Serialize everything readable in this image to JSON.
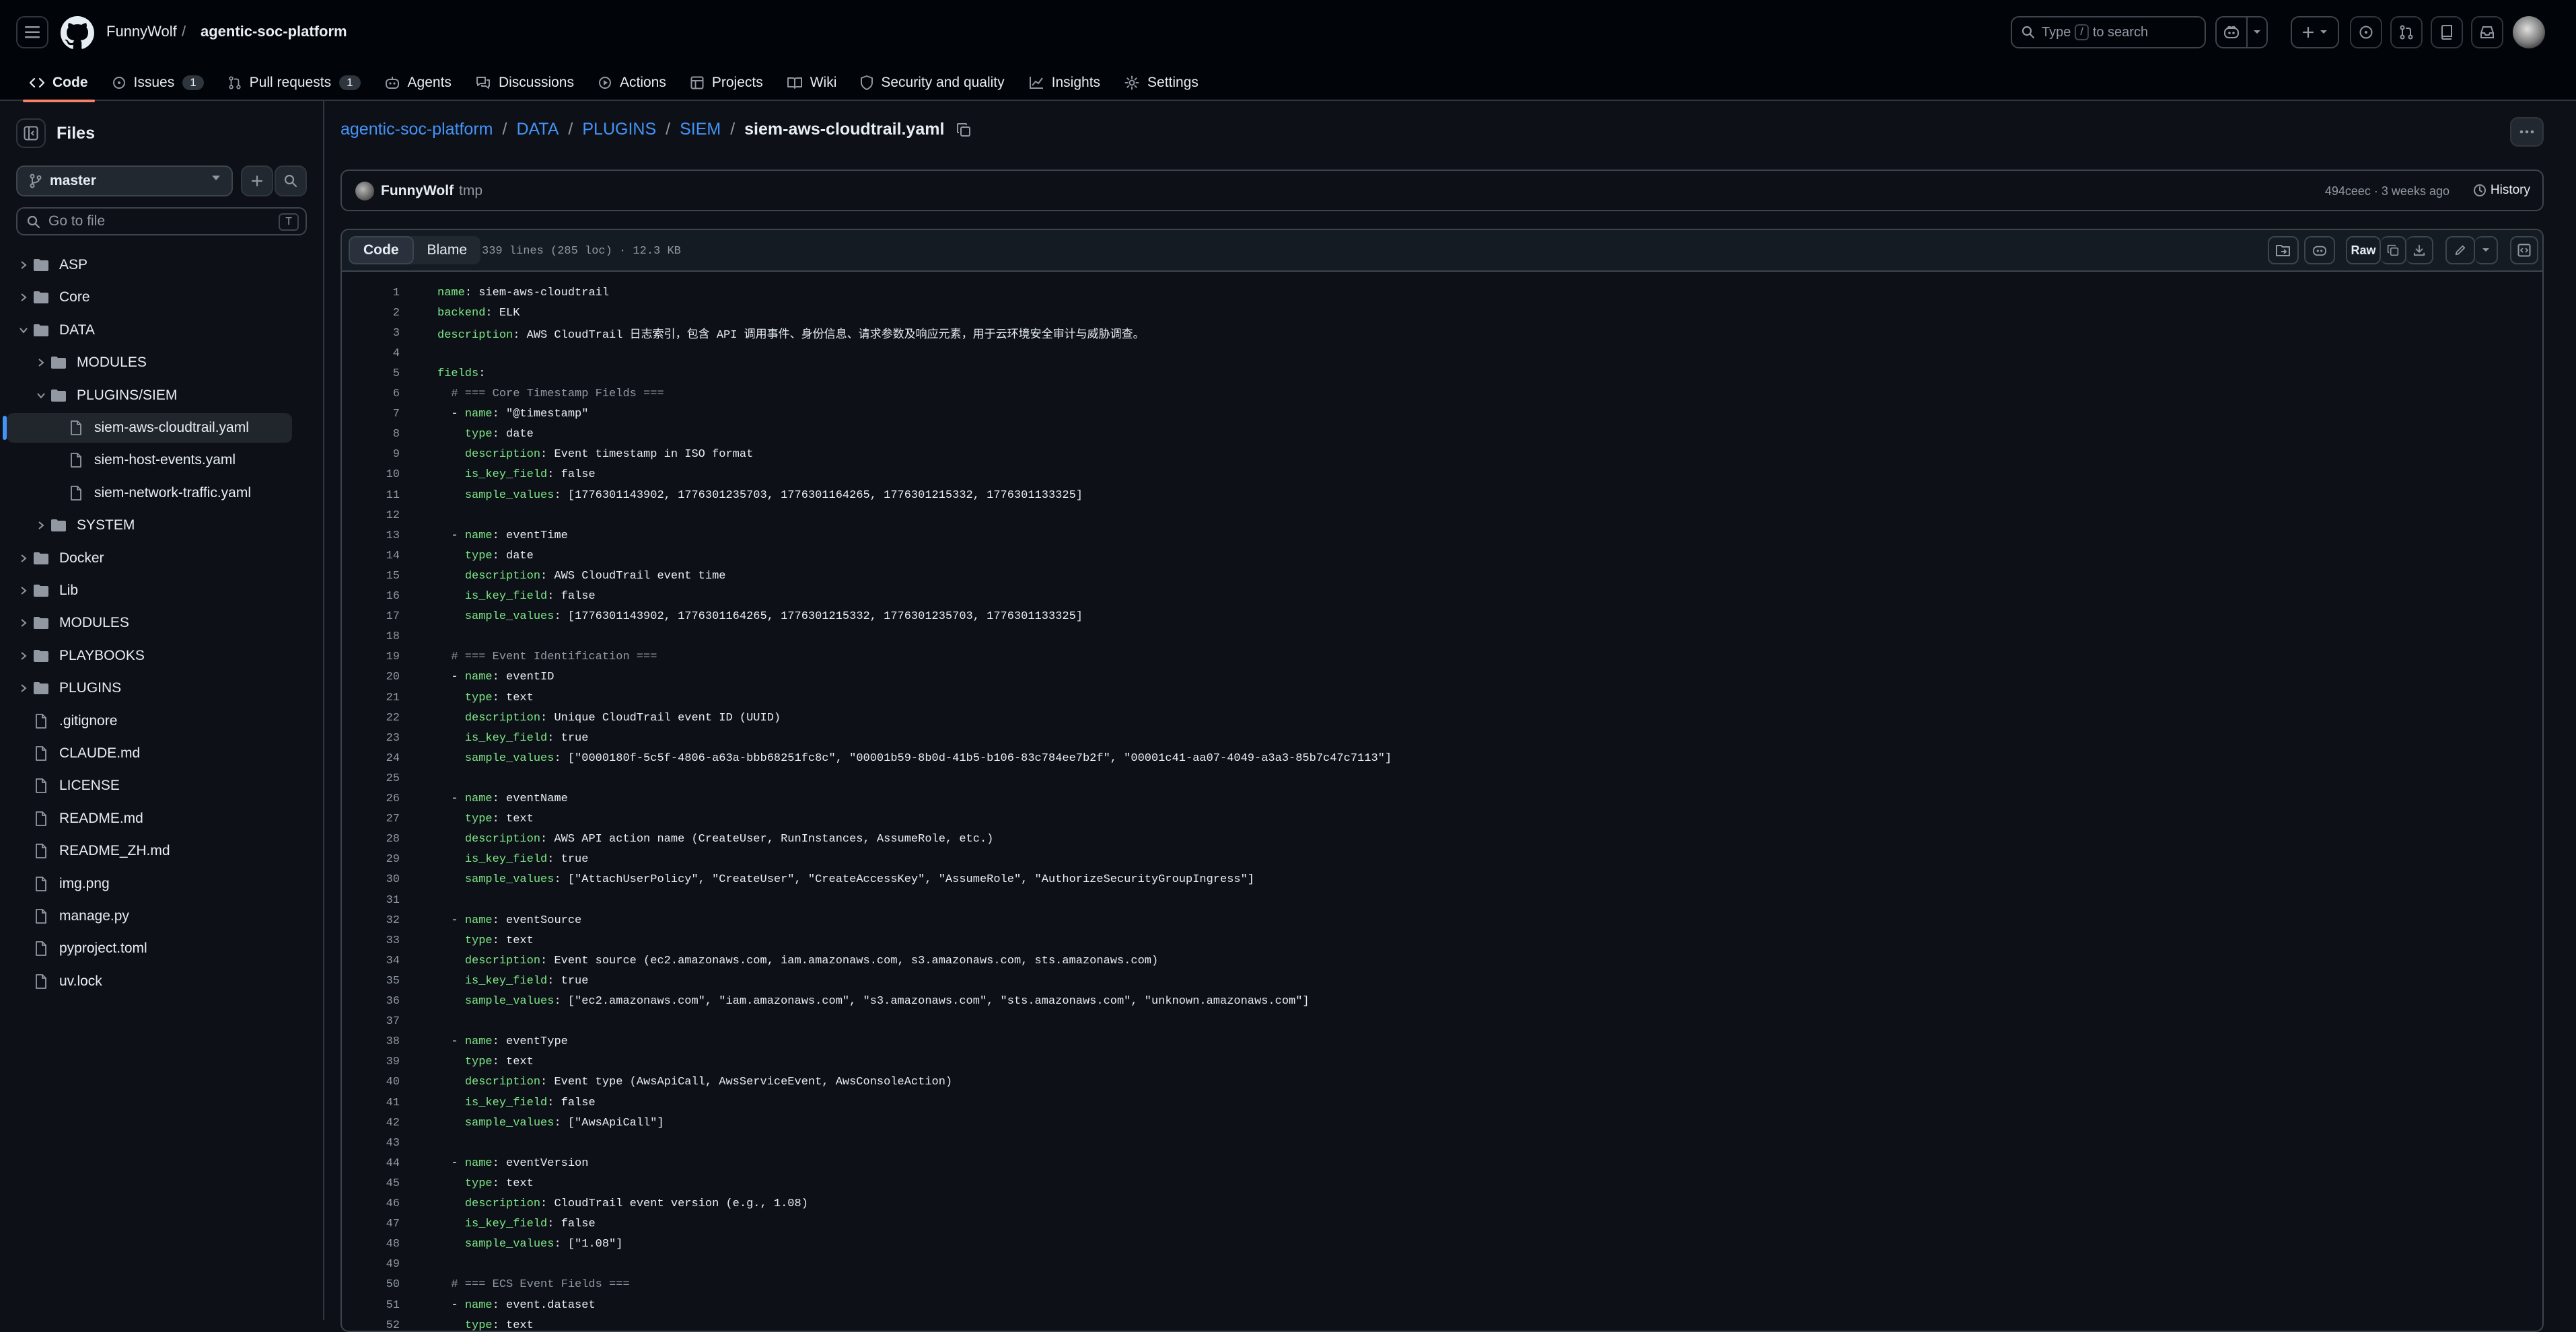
{
  "header": {
    "owner": "FunnyWolf",
    "separator": "/",
    "repo": "agentic-soc-platform",
    "search": {
      "prefix": "Type",
      "key": "/",
      "suffix": "to search"
    }
  },
  "nav": {
    "tabs": [
      {
        "label": "Code",
        "icon": "code-icon",
        "active": true
      },
      {
        "label": "Issues",
        "icon": "issue-icon",
        "count": "1"
      },
      {
        "label": "Pull requests",
        "icon": "pull-request-icon",
        "count": "1"
      },
      {
        "label": "Agents",
        "icon": "agent-icon"
      },
      {
        "label": "Discussions",
        "icon": "discussion-icon"
      },
      {
        "label": "Actions",
        "icon": "play-icon"
      },
      {
        "label": "Projects",
        "icon": "table-icon"
      },
      {
        "label": "Wiki",
        "icon": "book-icon"
      },
      {
        "label": "Security and quality",
        "icon": "shield-icon"
      },
      {
        "label": "Insights",
        "icon": "graph-icon"
      },
      {
        "label": "Settings",
        "icon": "gear-icon"
      }
    ]
  },
  "sidebar": {
    "title": "Files",
    "branch": "master",
    "goto_placeholder": "Go to file",
    "goto_key": "T",
    "tree": [
      {
        "label": "ASP",
        "type": "folder",
        "level": 0,
        "expanded": false
      },
      {
        "label": "Core",
        "type": "folder",
        "level": 0,
        "expanded": false
      },
      {
        "label": "DATA",
        "type": "folder",
        "level": 0,
        "expanded": true
      },
      {
        "label": "MODULES",
        "type": "folder",
        "level": 1,
        "expanded": false
      },
      {
        "label": "PLUGINS/SIEM",
        "type": "folder",
        "level": 1,
        "expanded": true
      },
      {
        "label": "siem-aws-cloudtrail.yaml",
        "type": "file",
        "level": 2,
        "selected": true
      },
      {
        "label": "siem-host-events.yaml",
        "type": "file",
        "level": 2
      },
      {
        "label": "siem-network-traffic.yaml",
        "type": "file",
        "level": 2
      },
      {
        "label": "SYSTEM",
        "type": "folder",
        "level": 1,
        "expanded": false
      },
      {
        "label": "Docker",
        "type": "folder",
        "level": 0,
        "expanded": false
      },
      {
        "label": "Lib",
        "type": "folder",
        "level": 0,
        "expanded": false
      },
      {
        "label": "MODULES",
        "type": "folder",
        "level": 0,
        "expanded": false
      },
      {
        "label": "PLAYBOOKS",
        "type": "folder",
        "level": 0,
        "expanded": false
      },
      {
        "label": "PLUGINS",
        "type": "folder",
        "level": 0,
        "expanded": false
      },
      {
        "label": ".gitignore",
        "type": "file",
        "level": 0
      },
      {
        "label": "CLAUDE.md",
        "type": "file",
        "level": 0
      },
      {
        "label": "LICENSE",
        "type": "file",
        "level": 0
      },
      {
        "label": "README.md",
        "type": "file",
        "level": 0
      },
      {
        "label": "README_ZH.md",
        "type": "file",
        "level": 0
      },
      {
        "label": "img.png",
        "type": "file",
        "level": 0
      },
      {
        "label": "manage.py",
        "type": "file",
        "level": 0
      },
      {
        "label": "pyproject.toml",
        "type": "file",
        "level": 0
      },
      {
        "label": "uv.lock",
        "type": "file",
        "level": 0
      }
    ]
  },
  "path": {
    "parts": [
      "agentic-soc-platform",
      "DATA",
      "PLUGINS",
      "SIEM"
    ],
    "separator": "/",
    "current": "siem-aws-cloudtrail.yaml"
  },
  "commit": {
    "author": "FunnyWolf",
    "message": "tmp",
    "meta": "494ceec · 3 weeks ago",
    "history_label": "History"
  },
  "file": {
    "tab_code": "Code",
    "tab_blame": "Blame",
    "info": "339 lines (285 loc) · 12.3 KB",
    "raw_label": "Raw",
    "lines": [
      [
        "1",
        [
          [
            "k",
            "name"
          ],
          [
            "p",
            ": "
          ],
          [
            "v",
            "siem-aws-cloudtrail"
          ]
        ]
      ],
      [
        "2",
        [
          [
            "k",
            "backend"
          ],
          [
            "p",
            ": "
          ],
          [
            "v",
            "ELK"
          ]
        ]
      ],
      [
        "3",
        [
          [
            "k",
            "description"
          ],
          [
            "p",
            ": "
          ],
          [
            "v",
            "AWS CloudTrail 日志索引，包含 API 调用事件、身份信息、请求参数及响应元素，用于云环境安全审计与威胁调查。"
          ]
        ]
      ],
      [
        "4",
        []
      ],
      [
        "5",
        [
          [
            "k",
            "fields"
          ],
          [
            "p",
            ":"
          ]
        ]
      ],
      [
        "6",
        [
          [
            "c",
            "  # === Core Timestamp Fields ==="
          ]
        ]
      ],
      [
        "7",
        [
          [
            "p",
            "  - "
          ],
          [
            "k",
            "name"
          ],
          [
            "p",
            ": "
          ],
          [
            "v",
            "\"@timestamp\""
          ]
        ]
      ],
      [
        "8",
        [
          [
            "p",
            "    "
          ],
          [
            "k",
            "type"
          ],
          [
            "p",
            ": "
          ],
          [
            "v",
            "date"
          ]
        ]
      ],
      [
        "9",
        [
          [
            "p",
            "    "
          ],
          [
            "k",
            "description"
          ],
          [
            "p",
            ": "
          ],
          [
            "v",
            "Event timestamp in ISO format"
          ]
        ]
      ],
      [
        "10",
        [
          [
            "p",
            "    "
          ],
          [
            "k",
            "is_key_field"
          ],
          [
            "p",
            ": "
          ],
          [
            "v",
            "false"
          ]
        ]
      ],
      [
        "11",
        [
          [
            "p",
            "    "
          ],
          [
            "k",
            "sample_values"
          ],
          [
            "p",
            ": "
          ],
          [
            "v",
            "[1776301143902, 1776301235703, 1776301164265, 1776301215332, 1776301133325]"
          ]
        ]
      ],
      [
        "12",
        []
      ],
      [
        "13",
        [
          [
            "p",
            "  - "
          ],
          [
            "k",
            "name"
          ],
          [
            "p",
            ": "
          ],
          [
            "v",
            "eventTime"
          ]
        ]
      ],
      [
        "14",
        [
          [
            "p",
            "    "
          ],
          [
            "k",
            "type"
          ],
          [
            "p",
            ": "
          ],
          [
            "v",
            "date"
          ]
        ]
      ],
      [
        "15",
        [
          [
            "p",
            "    "
          ],
          [
            "k",
            "description"
          ],
          [
            "p",
            ": "
          ],
          [
            "v",
            "AWS CloudTrail event time"
          ]
        ]
      ],
      [
        "16",
        [
          [
            "p",
            "    "
          ],
          [
            "k",
            "is_key_field"
          ],
          [
            "p",
            ": "
          ],
          [
            "v",
            "false"
          ]
        ]
      ],
      [
        "17",
        [
          [
            "p",
            "    "
          ],
          [
            "k",
            "sample_values"
          ],
          [
            "p",
            ": "
          ],
          [
            "v",
            "[1776301143902, 1776301164265, 1776301215332, 1776301235703, 1776301133325]"
          ]
        ]
      ],
      [
        "18",
        []
      ],
      [
        "19",
        [
          [
            "c",
            "  # === Event Identification ==="
          ]
        ]
      ],
      [
        "20",
        [
          [
            "p",
            "  - "
          ],
          [
            "k",
            "name"
          ],
          [
            "p",
            ": "
          ],
          [
            "v",
            "eventID"
          ]
        ]
      ],
      [
        "21",
        [
          [
            "p",
            "    "
          ],
          [
            "k",
            "type"
          ],
          [
            "p",
            ": "
          ],
          [
            "v",
            "text"
          ]
        ]
      ],
      [
        "22",
        [
          [
            "p",
            "    "
          ],
          [
            "k",
            "description"
          ],
          [
            "p",
            ": "
          ],
          [
            "v",
            "Unique CloudTrail event ID (UUID)"
          ]
        ]
      ],
      [
        "23",
        [
          [
            "p",
            "    "
          ],
          [
            "k",
            "is_key_field"
          ],
          [
            "p",
            ": "
          ],
          [
            "v",
            "true"
          ]
        ]
      ],
      [
        "24",
        [
          [
            "p",
            "    "
          ],
          [
            "k",
            "sample_values"
          ],
          [
            "p",
            ": "
          ],
          [
            "v",
            "[\"0000180f-5c5f-4806-a63a-bbb68251fc8c\", \"00001b59-8b0d-41b5-b106-83c784ee7b2f\", \"00001c41-aa07-4049-a3a3-85b7c47c7113\"]"
          ]
        ]
      ],
      [
        "25",
        []
      ],
      [
        "26",
        [
          [
            "p",
            "  - "
          ],
          [
            "k",
            "name"
          ],
          [
            "p",
            ": "
          ],
          [
            "v",
            "eventName"
          ]
        ]
      ],
      [
        "27",
        [
          [
            "p",
            "    "
          ],
          [
            "k",
            "type"
          ],
          [
            "p",
            ": "
          ],
          [
            "v",
            "text"
          ]
        ]
      ],
      [
        "28",
        [
          [
            "p",
            "    "
          ],
          [
            "k",
            "description"
          ],
          [
            "p",
            ": "
          ],
          [
            "v",
            "AWS API action name (CreateUser, RunInstances, AssumeRole, etc.)"
          ]
        ]
      ],
      [
        "29",
        [
          [
            "p",
            "    "
          ],
          [
            "k",
            "is_key_field"
          ],
          [
            "p",
            ": "
          ],
          [
            "v",
            "true"
          ]
        ]
      ],
      [
        "30",
        [
          [
            "p",
            "    "
          ],
          [
            "k",
            "sample_values"
          ],
          [
            "p",
            ": "
          ],
          [
            "v",
            "[\"AttachUserPolicy\", \"CreateUser\", \"CreateAccessKey\", \"AssumeRole\", \"AuthorizeSecurityGroupIngress\"]"
          ]
        ]
      ],
      [
        "31",
        []
      ],
      [
        "32",
        [
          [
            "p",
            "  - "
          ],
          [
            "k",
            "name"
          ],
          [
            "p",
            ": "
          ],
          [
            "v",
            "eventSource"
          ]
        ]
      ],
      [
        "33",
        [
          [
            "p",
            "    "
          ],
          [
            "k",
            "type"
          ],
          [
            "p",
            ": "
          ],
          [
            "v",
            "text"
          ]
        ]
      ],
      [
        "34",
        [
          [
            "p",
            "    "
          ],
          [
            "k",
            "description"
          ],
          [
            "p",
            ": "
          ],
          [
            "v",
            "Event source (ec2.amazonaws.com, iam.amazonaws.com, s3.amazonaws.com, sts.amazonaws.com)"
          ]
        ]
      ],
      [
        "35",
        [
          [
            "p",
            "    "
          ],
          [
            "k",
            "is_key_field"
          ],
          [
            "p",
            ": "
          ],
          [
            "v",
            "true"
          ]
        ]
      ],
      [
        "36",
        [
          [
            "p",
            "    "
          ],
          [
            "k",
            "sample_values"
          ],
          [
            "p",
            ": "
          ],
          [
            "v",
            "[\"ec2.amazonaws.com\", \"iam.amazonaws.com\", \"s3.amazonaws.com\", \"sts.amazonaws.com\", \"unknown.amazonaws.com\"]"
          ]
        ]
      ],
      [
        "37",
        []
      ],
      [
        "38",
        [
          [
            "p",
            "  - "
          ],
          [
            "k",
            "name"
          ],
          [
            "p",
            ": "
          ],
          [
            "v",
            "eventType"
          ]
        ]
      ],
      [
        "39",
        [
          [
            "p",
            "    "
          ],
          [
            "k",
            "type"
          ],
          [
            "p",
            ": "
          ],
          [
            "v",
            "text"
          ]
        ]
      ],
      [
        "40",
        [
          [
            "p",
            "    "
          ],
          [
            "k",
            "description"
          ],
          [
            "p",
            ": "
          ],
          [
            "v",
            "Event type (AwsApiCall, AwsServiceEvent, AwsConsoleAction)"
          ]
        ]
      ],
      [
        "41",
        [
          [
            "p",
            "    "
          ],
          [
            "k",
            "is_key_field"
          ],
          [
            "p",
            ": "
          ],
          [
            "v",
            "false"
          ]
        ]
      ],
      [
        "42",
        [
          [
            "p",
            "    "
          ],
          [
            "k",
            "sample_values"
          ],
          [
            "p",
            ": "
          ],
          [
            "v",
            "[\"AwsApiCall\"]"
          ]
        ]
      ],
      [
        "43",
        []
      ],
      [
        "44",
        [
          [
            "p",
            "  - "
          ],
          [
            "k",
            "name"
          ],
          [
            "p",
            ": "
          ],
          [
            "v",
            "eventVersion"
          ]
        ]
      ],
      [
        "45",
        [
          [
            "p",
            "    "
          ],
          [
            "k",
            "type"
          ],
          [
            "p",
            ": "
          ],
          [
            "v",
            "text"
          ]
        ]
      ],
      [
        "46",
        [
          [
            "p",
            "    "
          ],
          [
            "k",
            "description"
          ],
          [
            "p",
            ": "
          ],
          [
            "v",
            "CloudTrail event version (e.g., 1.08)"
          ]
        ]
      ],
      [
        "47",
        [
          [
            "p",
            "    "
          ],
          [
            "k",
            "is_key_field"
          ],
          [
            "p",
            ": "
          ],
          [
            "v",
            "false"
          ]
        ]
      ],
      [
        "48",
        [
          [
            "p",
            "    "
          ],
          [
            "k",
            "sample_values"
          ],
          [
            "p",
            ": "
          ],
          [
            "v",
            "[\"1.08\"]"
          ]
        ]
      ],
      [
        "49",
        []
      ],
      [
        "50",
        [
          [
            "c",
            "  # === ECS Event Fields ==="
          ]
        ]
      ],
      [
        "51",
        [
          [
            "p",
            "  - "
          ],
          [
            "k",
            "name"
          ],
          [
            "p",
            ": "
          ],
          [
            "v",
            "event.dataset"
          ]
        ]
      ],
      [
        "52",
        [
          [
            "p",
            "    "
          ],
          [
            "k",
            "type"
          ],
          [
            "p",
            ": "
          ],
          [
            "v",
            "text"
          ]
        ]
      ]
    ]
  }
}
